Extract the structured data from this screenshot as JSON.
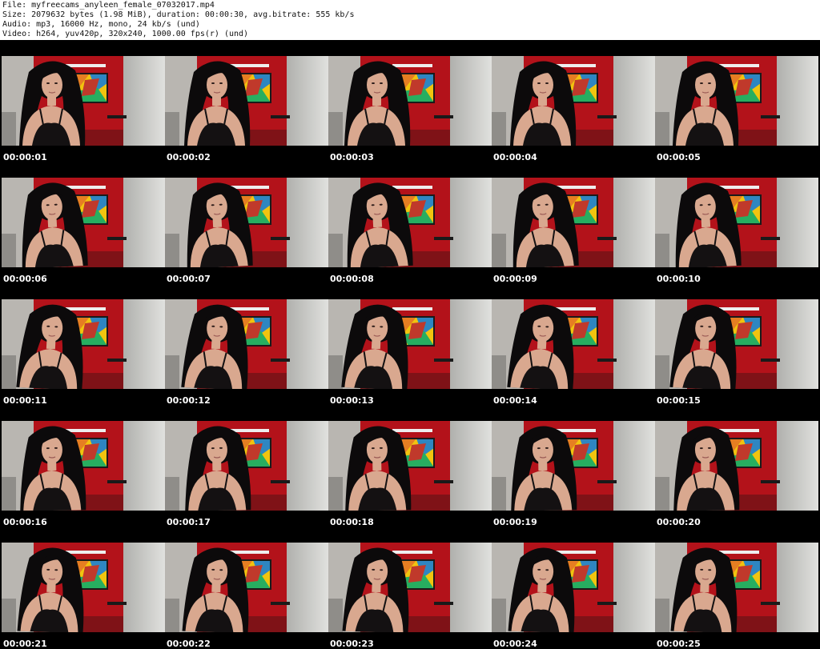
{
  "header": {
    "file_line": "File: myfreecams_anyleen_female_07032017.mp4",
    "size_line": "Size: 2079632 bytes (1.98 MiB), duration: 00:00:30, avg.bitrate: 555 kb/s",
    "audio_line": "Audio: mp3, 16000 Hz, mono, 24 kb/s (und)",
    "video_line": "Video: h264, yuv420p, 320x240, 1000.00 fps(r) (und)"
  },
  "thumbnails": [
    {
      "timestamp": "00:00:01"
    },
    {
      "timestamp": "00:00:02"
    },
    {
      "timestamp": "00:00:03"
    },
    {
      "timestamp": "00:00:04"
    },
    {
      "timestamp": "00:00:05"
    },
    {
      "timestamp": "00:00:06"
    },
    {
      "timestamp": "00:00:07"
    },
    {
      "timestamp": "00:00:08"
    },
    {
      "timestamp": "00:00:09"
    },
    {
      "timestamp": "00:00:10"
    },
    {
      "timestamp": "00:00:11"
    },
    {
      "timestamp": "00:00:12"
    },
    {
      "timestamp": "00:00:13"
    },
    {
      "timestamp": "00:00:14"
    },
    {
      "timestamp": "00:00:15"
    },
    {
      "timestamp": "00:00:16"
    },
    {
      "timestamp": "00:00:17"
    },
    {
      "timestamp": "00:00:18"
    },
    {
      "timestamp": "00:00:19"
    },
    {
      "timestamp": "00:00:20"
    },
    {
      "timestamp": "00:00:21"
    },
    {
      "timestamp": "00:00:22"
    },
    {
      "timestamp": "00:00:23"
    },
    {
      "timestamp": "00:00:24"
    },
    {
      "timestamp": "00:00:25"
    }
  ],
  "colors": {
    "background": "#000000",
    "header_background": "#ffffff",
    "header_text": "#111111",
    "timestamp_text": "#ffffff",
    "wall_red": "#b3121a",
    "wall_grey": "#cfd0cc",
    "hair": "#0c0a0b",
    "skin": "#d9a88f"
  }
}
